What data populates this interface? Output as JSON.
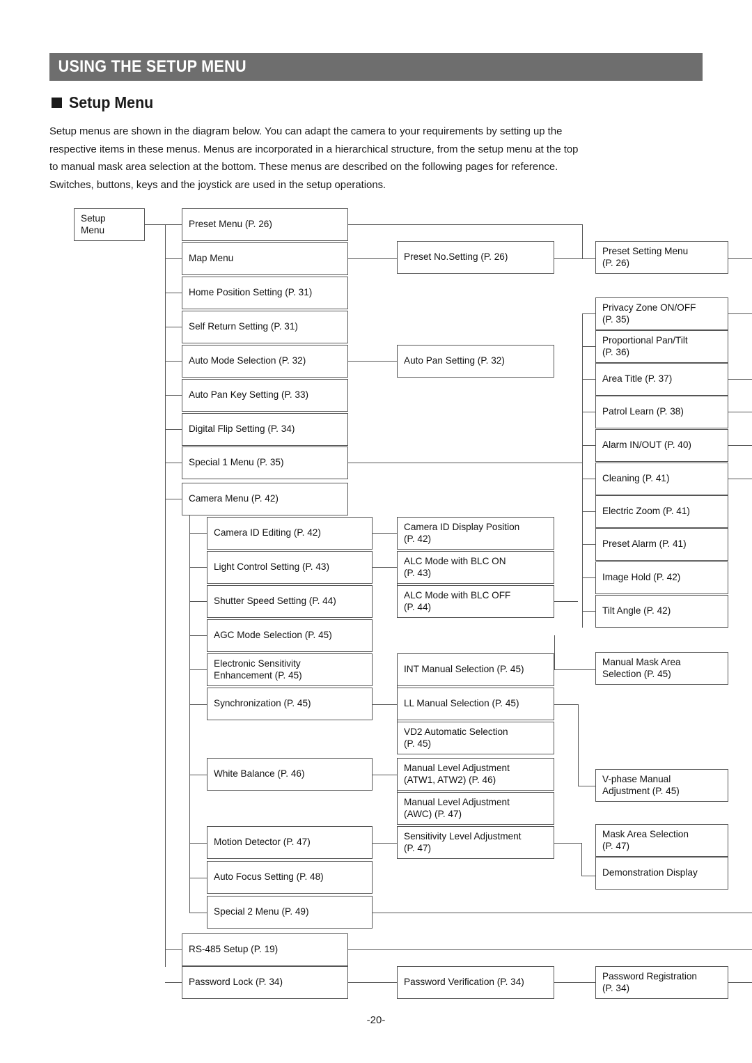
{
  "header": {
    "title": "USING THE SETUP MENU"
  },
  "section": {
    "heading": "Setup Menu",
    "bullet_icon": "filled-square-icon"
  },
  "intro": {
    "line1": "Setup menus are shown in the diagram below. You can adapt the camera to your requirements by setting up the",
    "line2": "respective items in these menus.  Menus are incorporated in a hierarchical structure, from the setup menu at the top",
    "line3": "to manual mask area selection at the bottom. These menus are described on the following pages for reference.",
    "line4": "Switches, buttons, keys and the joystick are used in the setup operations."
  },
  "diagram": {
    "root": "Setup\nMenu",
    "level1": [
      "Preset Menu (P. 26)",
      "Map Menu",
      "Home Position Setting (P. 31)",
      "Self Return Setting (P. 31)",
      "Auto Mode Selection (P. 32)",
      "Auto Pan Key Setting (P. 33)",
      "Digital Flip Setting (P. 34)",
      "Special 1 Menu (P. 35)",
      "Camera Menu (P. 42)"
    ],
    "camera_submenu": [
      "Camera ID Editing (P. 42)",
      "Light Control Setting (P. 43)",
      "Shutter Speed Setting (P. 44)",
      "AGC Mode Selection (P. 45)",
      "Electronic Sensitivity\nEnhancement (P. 45)",
      "Synchronization (P. 45)",
      "White Balance (P. 46)",
      "Motion Detector (P. 47)",
      "Auto Focus Setting (P. 48)",
      "Special 2 Menu (P. 49)"
    ],
    "bottom_level1": [
      "RS-485 Setup (P. 19)",
      "Password Lock (P. 34)"
    ],
    "level2": [
      "Preset No.Setting (P. 26)",
      "Auto Pan Setting (P. 32)",
      "Camera ID Display Position\n(P. 42)",
      "ALC Mode with BLC ON\n(P. 43)",
      "ALC Mode with BLC OFF\n(P. 44)",
      "INT Manual Selection (P. 45)",
      "LL Manual Selection (P. 45)",
      "VD2 Automatic Selection\n(P. 45)",
      "Manual Level Adjustment\n(ATW1, ATW2) (P. 46)",
      "Manual Level Adjustment\n(AWC) (P. 47)",
      "Sensitivity Level Adjustment\n(P. 47)",
      "Password Verification (P. 34)"
    ],
    "level3": [
      "Preset Setting Menu\n(P. 26)",
      "Privacy Zone ON/OFF\n(P. 35)",
      "Proportional Pan/Tilt\n(P. 36)",
      "Area Title (P. 37)",
      "Patrol Learn (P. 38)",
      "Alarm IN/OUT (P. 40)",
      "Cleaning (P. 41)",
      "Electric Zoom (P. 41)",
      "Preset Alarm (P. 41)",
      "Image Hold (P. 42)",
      "Tilt Angle (P. 42)",
      "Manual Mask Area\nSelection (P. 45)",
      "V-phase Manual\nAdjustment (P. 45)",
      "Mask Area Selection\n(P. 47)",
      "Demonstration Display",
      "Password Registration\n(P. 34)"
    ]
  },
  "footer": {
    "page_number": "-20-"
  },
  "colors": {
    "header_bg": "#6e6e6e",
    "header_text": "#ffffff",
    "box_border": "#555555",
    "body_text": "#1a1a1a"
  }
}
